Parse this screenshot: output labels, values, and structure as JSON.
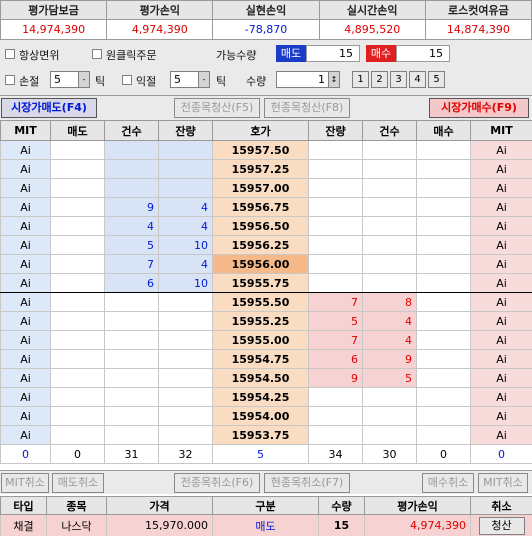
{
  "summary": [
    {
      "label": "평가담보금",
      "value": "14,974,390",
      "color": "red"
    },
    {
      "label": "평가손익",
      "value": "4,974,390",
      "color": "red"
    },
    {
      "label": "실현손익",
      "value": "-78,870",
      "color": "blue"
    },
    {
      "label": "실시간손익",
      "value": "4,895,520",
      "color": "red"
    },
    {
      "label": "로스컷여유금",
      "value": "14,874,390",
      "color": "red"
    }
  ],
  "controls": {
    "always_top": "항상면위",
    "one_click": "원클릭주문",
    "available_qty": "가능수량",
    "sell_tag": "매도",
    "sell_qty": "15",
    "buy_tag": "매수",
    "buy_qty": "15",
    "stoploss": "손절",
    "stoploss_ticks": "5",
    "tick1": "틱",
    "takeprofit": "익절",
    "takeprofit_ticks": "5",
    "tick2": "틱",
    "qty_label": "수량",
    "qty_value": "1",
    "qty_presets": [
      "1",
      "2",
      "3",
      "4",
      "5"
    ]
  },
  "actions": {
    "market_sell": "시장가매도(F4)",
    "all_clear": "전종목청산(F5)",
    "cur_clear": "현종목청산(F8)",
    "market_buy": "시장가매수(F9)"
  },
  "book": {
    "headers": [
      "MIT",
      "매도",
      "건수",
      "잔량",
      "호가",
      "잔량",
      "건수",
      "매수",
      "MIT"
    ],
    "mit_label": "Ai",
    "asks": [
      {
        "price": "15957.50",
        "cnt": "",
        "rem": ""
      },
      {
        "price": "15957.25",
        "cnt": "",
        "rem": ""
      },
      {
        "price": "15957.00",
        "cnt": "",
        "rem": ""
      },
      {
        "price": "15956.75",
        "cnt": "9",
        "rem": "4"
      },
      {
        "price": "15956.50",
        "cnt": "4",
        "rem": "4"
      },
      {
        "price": "15956.25",
        "cnt": "5",
        "rem": "10"
      },
      {
        "price": "15956.00",
        "cnt": "7",
        "rem": "4",
        "current": true
      },
      {
        "price": "15955.75",
        "cnt": "6",
        "rem": "10"
      }
    ],
    "bids": [
      {
        "price": "15955.50",
        "rem": "7",
        "cnt": "8"
      },
      {
        "price": "15955.25",
        "rem": "5",
        "cnt": "4"
      },
      {
        "price": "15955.00",
        "rem": "7",
        "cnt": "4"
      },
      {
        "price": "15954.75",
        "rem": "6",
        "cnt": "9"
      },
      {
        "price": "15954.50",
        "rem": "9",
        "cnt": "5"
      },
      {
        "price": "15954.25",
        "rem": "",
        "cnt": ""
      },
      {
        "price": "15954.00",
        "rem": "",
        "cnt": ""
      },
      {
        "price": "15953.75",
        "rem": "",
        "cnt": ""
      }
    ],
    "footer": [
      "0",
      "0",
      "31",
      "32",
      "5",
      "34",
      "30",
      "0",
      "0"
    ]
  },
  "cancel": {
    "mit_cancel_l": "MIT취소",
    "sell_cancel": "매도취소",
    "all_cancel": "전종목취소(F6)",
    "cur_cancel": "현종목취소(F7)",
    "buy_cancel": "매수취소",
    "mit_cancel_r": "MIT취소"
  },
  "position": {
    "headers": [
      "타입",
      "종목",
      "가격",
      "구분",
      "수량",
      "평가손익",
      "취소"
    ],
    "row": {
      "type": "채결",
      "symbol": "나스닥",
      "price": "15,970.000",
      "side": "매도",
      "qty": "15",
      "pnl": "4,974,390",
      "clear": "청산"
    }
  }
}
